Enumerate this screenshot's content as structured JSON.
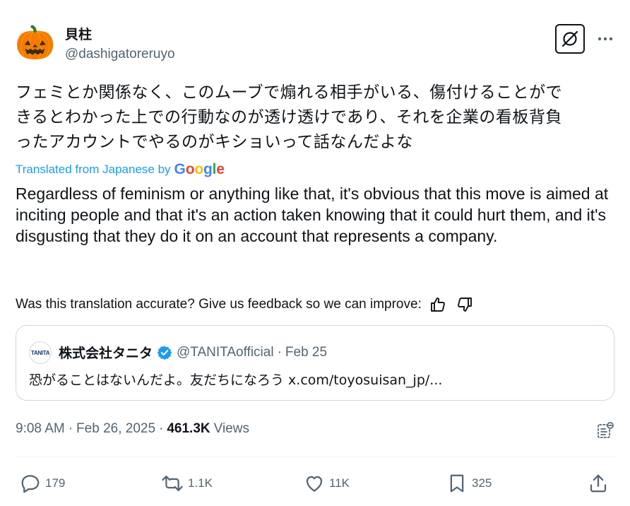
{
  "author": {
    "display_name": "貝柱",
    "handle": "@dashigatoreruyo",
    "avatar_emoji": "🎃"
  },
  "tweet": {
    "lines": [
      "フェミとか関係なく、このムーブで煽れる相手がいる、傷付けることがで",
      "きるとわかった上での行動なのが透け透けであり、それを企業の看板背負",
      "ったアカウントでやるのがキショいって話なんだよな"
    ]
  },
  "translation": {
    "label": "Translated from Japanese by",
    "provider_letters": [
      "G",
      "o",
      "o",
      "g",
      "l",
      "e"
    ],
    "provider_colors": [
      "#4285F4",
      "#EA4335",
      "#FBBC05",
      "#4285F4",
      "#34A853",
      "#EA4335"
    ],
    "text": "Regardless of feminism or anything like that, it's obvious that this move is aimed at inciting people and that it's an action taken knowing that it could hurt them, and it's disgusting that they do it on an account that represents a company.",
    "feedback_prompt": "Was this translation accurate? Give us feedback so we can improve:"
  },
  "quote": {
    "avatar_text": "TANITA",
    "name": "株式会社タニタ",
    "handle": "@TANITAofficial",
    "separator": "·",
    "date": "Feb 25",
    "text": "恐がることはないんだよ。友だちになろう x.com/toyosuisan_jp/..."
  },
  "meta": {
    "time": "9:08 AM",
    "separator": "·",
    "date": "Feb 26, 2025",
    "views_count": "461.3K",
    "views_label": "Views"
  },
  "actions": {
    "replies": "179",
    "reposts": "1.1K",
    "likes": "11K",
    "bookmarks": "325"
  },
  "colors": {
    "accent": "#1d9bf0",
    "muted": "#536471",
    "text": "#0f1419",
    "border": "#cfd9de"
  }
}
